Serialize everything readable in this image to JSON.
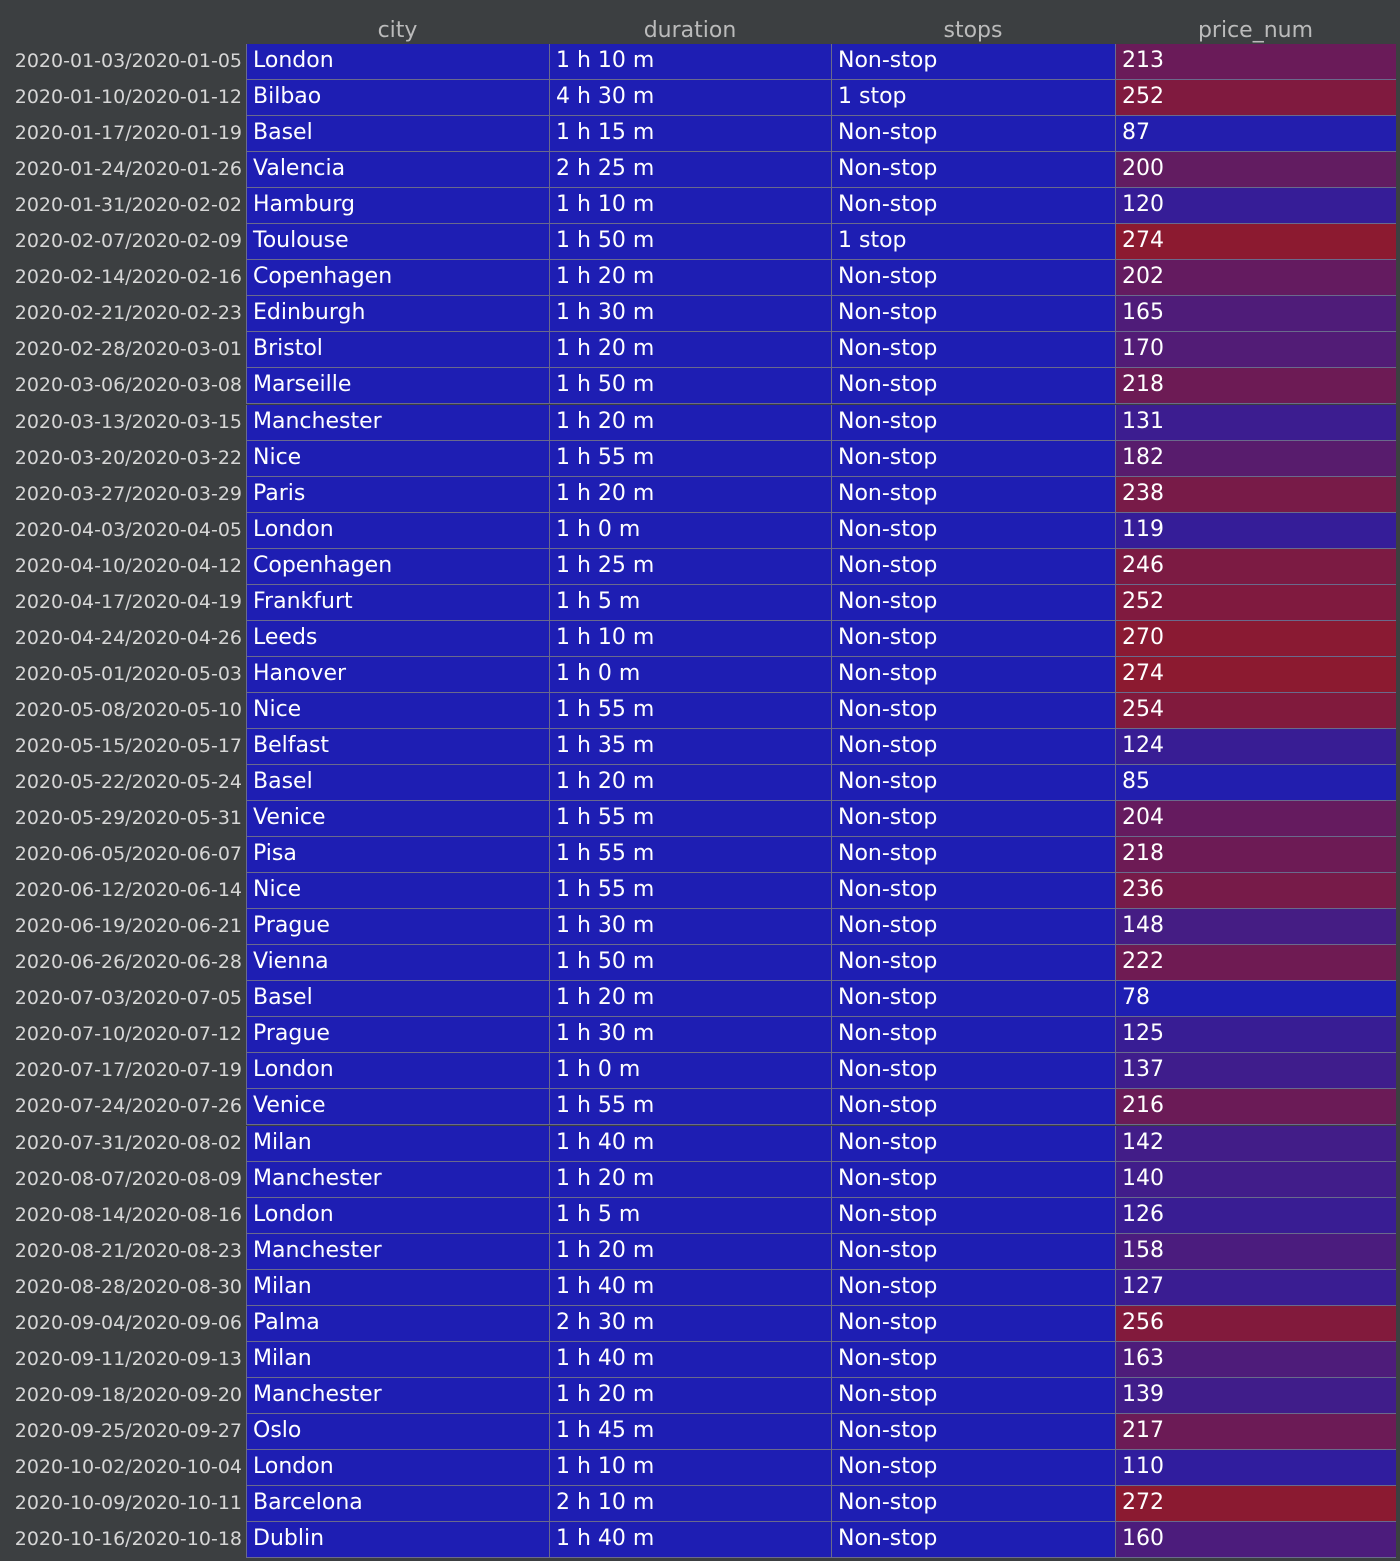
{
  "columns": {
    "city": "city",
    "duration": "duration",
    "stops": "stops",
    "price": "price_num"
  },
  "colors": {
    "low": "#1e1eb3",
    "high": "#8c1a30",
    "background": "#3c3f41",
    "cell_blue": "#1e1eb3"
  },
  "price_scale": [
    78,
    274
  ],
  "rows": [
    {
      "index": "2020-01-03/2020-01-05",
      "city": "London",
      "duration": "1 h 10 m",
      "stops": "Non-stop",
      "price": 213
    },
    {
      "index": "2020-01-10/2020-01-12",
      "city": "Bilbao",
      "duration": "4 h 30 m",
      "stops": "1 stop",
      "price": 252
    },
    {
      "index": "2020-01-17/2020-01-19",
      "city": "Basel",
      "duration": "1 h 15 m",
      "stops": "Non-stop",
      "price": 87
    },
    {
      "index": "2020-01-24/2020-01-26",
      "city": "Valencia",
      "duration": "2 h 25 m",
      "stops": "Non-stop",
      "price": 200
    },
    {
      "index": "2020-01-31/2020-02-02",
      "city": "Hamburg",
      "duration": "1 h 10 m",
      "stops": "Non-stop",
      "price": 120
    },
    {
      "index": "2020-02-07/2020-02-09",
      "city": "Toulouse",
      "duration": "1 h 50 m",
      "stops": "1 stop",
      "price": 274
    },
    {
      "index": "2020-02-14/2020-02-16",
      "city": "Copenhagen",
      "duration": "1 h 20 m",
      "stops": "Non-stop",
      "price": 202
    },
    {
      "index": "2020-02-21/2020-02-23",
      "city": "Edinburgh",
      "duration": "1 h 30 m",
      "stops": "Non-stop",
      "price": 165
    },
    {
      "index": "2020-02-28/2020-03-01",
      "city": "Bristol",
      "duration": "1 h 20 m",
      "stops": "Non-stop",
      "price": 170
    },
    {
      "index": "2020-03-06/2020-03-08",
      "city": "Marseille",
      "duration": "1 h 50 m",
      "stops": "Non-stop",
      "price": 218
    },
    {
      "index": "2020-03-13/2020-03-15",
      "city": "Manchester",
      "duration": "1 h 20 m",
      "stops": "Non-stop",
      "price": 131
    },
    {
      "index": "2020-03-20/2020-03-22",
      "city": "Nice",
      "duration": "1 h 55 m",
      "stops": "Non-stop",
      "price": 182
    },
    {
      "index": "2020-03-27/2020-03-29",
      "city": "Paris",
      "duration": "1 h 20 m",
      "stops": "Non-stop",
      "price": 238
    },
    {
      "index": "2020-04-03/2020-04-05",
      "city": "London",
      "duration": "1 h 0 m",
      "stops": "Non-stop",
      "price": 119
    },
    {
      "index": "2020-04-10/2020-04-12",
      "city": "Copenhagen",
      "duration": "1 h 25 m",
      "stops": "Non-stop",
      "price": 246
    },
    {
      "index": "2020-04-17/2020-04-19",
      "city": "Frankfurt",
      "duration": "1 h 5 m",
      "stops": "Non-stop",
      "price": 252
    },
    {
      "index": "2020-04-24/2020-04-26",
      "city": "Leeds",
      "duration": "1 h 10 m",
      "stops": "Non-stop",
      "price": 270
    },
    {
      "index": "2020-05-01/2020-05-03",
      "city": "Hanover",
      "duration": "1 h 0 m",
      "stops": "Non-stop",
      "price": 274
    },
    {
      "index": "2020-05-08/2020-05-10",
      "city": "Nice",
      "duration": "1 h 55 m",
      "stops": "Non-stop",
      "price": 254
    },
    {
      "index": "2020-05-15/2020-05-17",
      "city": "Belfast",
      "duration": "1 h 35 m",
      "stops": "Non-stop",
      "price": 124
    },
    {
      "index": "2020-05-22/2020-05-24",
      "city": "Basel",
      "duration": "1 h 20 m",
      "stops": "Non-stop",
      "price": 85
    },
    {
      "index": "2020-05-29/2020-05-31",
      "city": "Venice",
      "duration": "1 h 55 m",
      "stops": "Non-stop",
      "price": 204
    },
    {
      "index": "2020-06-05/2020-06-07",
      "city": "Pisa",
      "duration": "1 h 55 m",
      "stops": "Non-stop",
      "price": 218
    },
    {
      "index": "2020-06-12/2020-06-14",
      "city": "Nice",
      "duration": "1 h 55 m",
      "stops": "Non-stop",
      "price": 236
    },
    {
      "index": "2020-06-19/2020-06-21",
      "city": "Prague",
      "duration": "1 h 30 m",
      "stops": "Non-stop",
      "price": 148
    },
    {
      "index": "2020-06-26/2020-06-28",
      "city": "Vienna",
      "duration": "1 h 50 m",
      "stops": "Non-stop",
      "price": 222
    },
    {
      "index": "2020-07-03/2020-07-05",
      "city": "Basel",
      "duration": "1 h 20 m",
      "stops": "Non-stop",
      "price": 78
    },
    {
      "index": "2020-07-10/2020-07-12",
      "city": "Prague",
      "duration": "1 h 30 m",
      "stops": "Non-stop",
      "price": 125
    },
    {
      "index": "2020-07-17/2020-07-19",
      "city": "London",
      "duration": "1 h 0 m",
      "stops": "Non-stop",
      "price": 137
    },
    {
      "index": "2020-07-24/2020-07-26",
      "city": "Venice",
      "duration": "1 h 55 m",
      "stops": "Non-stop",
      "price": 216
    },
    {
      "index": "2020-07-31/2020-08-02",
      "city": "Milan",
      "duration": "1 h 40 m",
      "stops": "Non-stop",
      "price": 142
    },
    {
      "index": "2020-08-07/2020-08-09",
      "city": "Manchester",
      "duration": "1 h 20 m",
      "stops": "Non-stop",
      "price": 140
    },
    {
      "index": "2020-08-14/2020-08-16",
      "city": "London",
      "duration": "1 h 5 m",
      "stops": "Non-stop",
      "price": 126
    },
    {
      "index": "2020-08-21/2020-08-23",
      "city": "Manchester",
      "duration": "1 h 20 m",
      "stops": "Non-stop",
      "price": 158
    },
    {
      "index": "2020-08-28/2020-08-30",
      "city": "Milan",
      "duration": "1 h 40 m",
      "stops": "Non-stop",
      "price": 127
    },
    {
      "index": "2020-09-04/2020-09-06",
      "city": "Palma",
      "duration": "2 h 30 m",
      "stops": "Non-stop",
      "price": 256
    },
    {
      "index": "2020-09-11/2020-09-13",
      "city": "Milan",
      "duration": "1 h 40 m",
      "stops": "Non-stop",
      "price": 163
    },
    {
      "index": "2020-09-18/2020-09-20",
      "city": "Manchester",
      "duration": "1 h 20 m",
      "stops": "Non-stop",
      "price": 139
    },
    {
      "index": "2020-09-25/2020-09-27",
      "city": "Oslo",
      "duration": "1 h 45 m",
      "stops": "Non-stop",
      "price": 217
    },
    {
      "index": "2020-10-02/2020-10-04",
      "city": "London",
      "duration": "1 h 10 m",
      "stops": "Non-stop",
      "price": 110
    },
    {
      "index": "2020-10-09/2020-10-11",
      "city": "Barcelona",
      "duration": "2 h 10 m",
      "stops": "Non-stop",
      "price": 272
    },
    {
      "index": "2020-10-16/2020-10-18",
      "city": "Dublin",
      "duration": "1 h 40 m",
      "stops": "Non-stop",
      "price": 160
    }
  ]
}
